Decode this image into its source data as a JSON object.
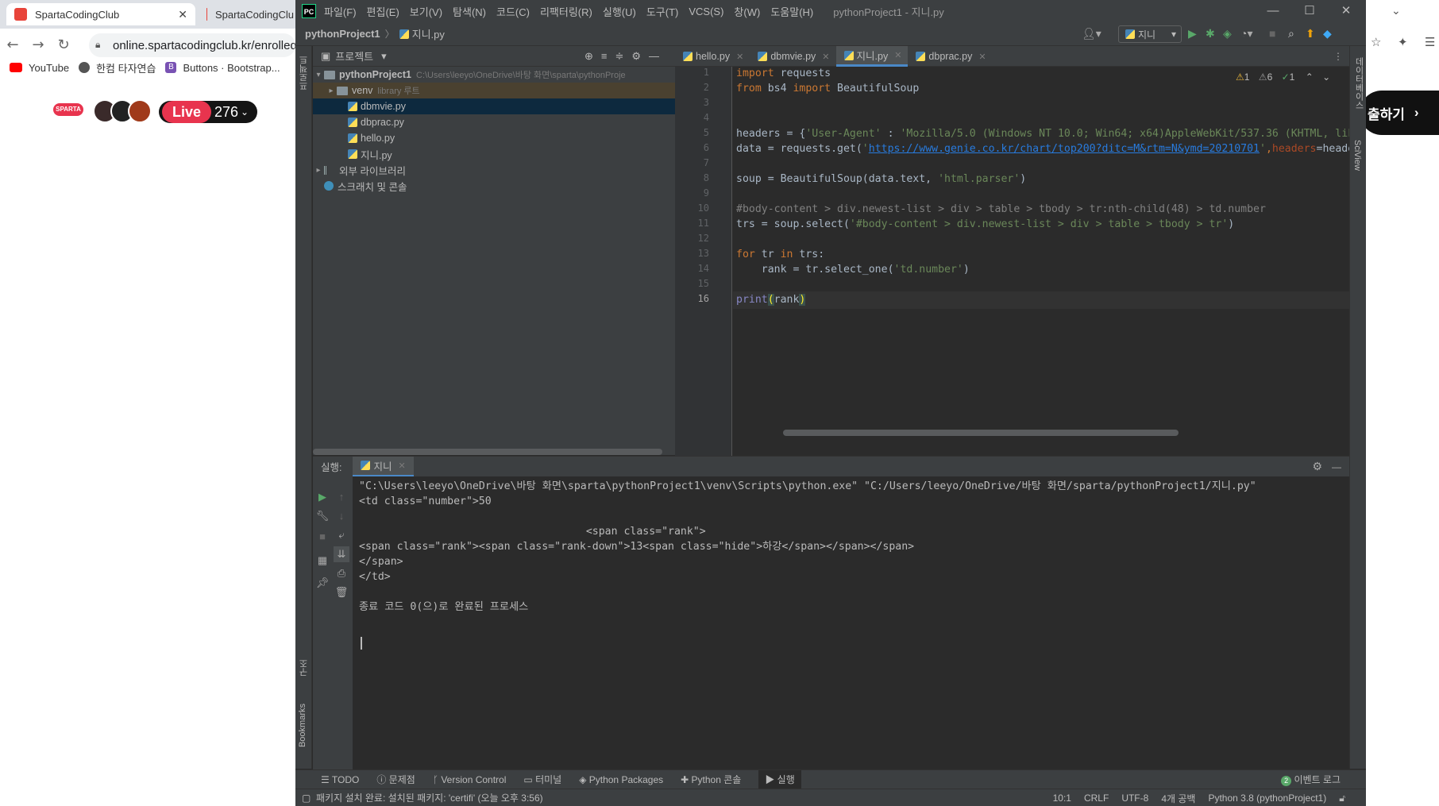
{
  "browser": {
    "tabs": [
      {
        "title": "SpartaCodingClub"
      },
      {
        "title": "SpartaCodingClu"
      }
    ],
    "address": "online.spartacodingclub.kr/enrolleds",
    "bookmarks": [
      "YouTube",
      "한컴 타자연습",
      "Buttons · Bootstrap..."
    ],
    "bookmark_b_icon": "B",
    "live_label": "Live",
    "live_count": "276",
    "cta_text": "출하기"
  },
  "ide": {
    "menu": [
      "파일(F)",
      "편집(E)",
      "보기(V)",
      "탐색(N)",
      "코드(C)",
      "리팩터링(R)",
      "실행(U)",
      "도구(T)",
      "VCS(S)",
      "창(W)",
      "도움말(H)"
    ],
    "window_title": "pythonProject1 - 지니.py",
    "logo_text": "PC",
    "breadcrumb": {
      "project": "pythonProject1",
      "file": "지니.py"
    },
    "run_config": "지니",
    "left_stripe": [
      "프로젝트",
      "구조",
      "Bookmarks"
    ],
    "right_stripe": [
      "데이터베이스",
      "SciView"
    ],
    "project_panel": {
      "title": "프로젝트",
      "root": "pythonProject1",
      "root_path": "C:\\Users\\leeyo\\OneDrive\\바탕 화면\\sparta\\pythonProje",
      "venv": "venv",
      "venv_hint": "library 루트",
      "files": [
        "dbmvie.py",
        "dbprac.py",
        "hello.py",
        "지니.py"
      ],
      "external_libs": "외부 라이브러리",
      "scratches": "스크래치 및 콘솔"
    },
    "editor_tabs": [
      "hello.py",
      "dbmvie.py",
      "지니.py",
      "dbprac.py"
    ],
    "inspections": {
      "warn": "1",
      "weak": "6",
      "ok": "1"
    },
    "line_numbers": [
      "1",
      "2",
      "3",
      "4",
      "5",
      "6",
      "7",
      "8",
      "9",
      "10",
      "11",
      "12",
      "13",
      "14",
      "15",
      "16"
    ],
    "code": {
      "l1_kw": "import",
      "l1_rest": " requests",
      "l2_kw1": "from",
      "l2_mod": " bs4 ",
      "l2_kw2": "import",
      "l2_rest": " BeautifulSoup",
      "l5_a": "headers = {",
      "l5_s1": "'User-Agent'",
      "l5_b": " : ",
      "l5_s2": "'Mozilla/5.0 (Windows NT 10.0; Win64; x64)AppleWebKit/537.36 (KHTML, lik",
      "l6_a": "data = requests.get(",
      "l6_q1": "'",
      "l6_url": "https://www.genie.co.kr/chart/top200?ditc=M&rtm=N&ymd=20210701",
      "l6_q2": "'",
      "l6_comma": ",",
      "l6_param": "headers",
      "l6_rest": "=heade",
      "l8_a": "soup = BeautifulSoup(data.text, ",
      "l8_s": "'html.parser'",
      "l8_b": ")",
      "l10_cm": "#body-content > div.newest-list > div > table > tbody > tr:nth-child(48) > td.number",
      "l11_a": "trs = soup.select(",
      "l11_s": "'#body-content > div.newest-list > div > table > tbody > tr'",
      "l11_b": ")",
      "l13_kw1": "for",
      "l13_a": " tr ",
      "l13_kw2": "in",
      "l13_b": " trs:",
      "l14_a": "    rank",
      "l14_b": " = tr.select_one(",
      "l14_s": "'td.number'",
      "l14_c": ")",
      "l16_fn": "print",
      "l16_p1": "(",
      "l16_arg": "rank",
      "l16_p2": ")"
    },
    "run_panel": {
      "label": "실행:",
      "tab": "지니",
      "output": [
        "\"C:\\Users\\leeyo\\OneDrive\\바탕 화면\\sparta\\pythonProject1\\venv\\Scripts\\python.exe\" \"C:/Users/leeyo/OneDrive/바탕 화면/sparta/pythonProject1/지니.py\"",
        "<td class=\"number\">50",
        "",
        "                                    <span class=\"rank\">",
        "<span class=\"rank\"><span class=\"rank-down\">13<span class=\"hide\">하강</span></span></span>",
        "</span>",
        "</td>",
        "",
        "종료 코드 0(으)로 완료된 프로세스"
      ]
    },
    "bottom_tools": [
      "TODO",
      "문제점",
      "Version Control",
      "터미널",
      "Python Packages",
      "Python 콘솔",
      "실행"
    ],
    "event_log": "이벤트 로그",
    "event_count": "2",
    "status_message": "패키지 설치 완료: 설치된 패키지: 'certifi' (오늘 오후 3:56)",
    "status_right": [
      "10:1",
      "CRLF",
      "UTF-8",
      "4개 공백",
      "Python 3.8 (pythonProject1)"
    ]
  }
}
